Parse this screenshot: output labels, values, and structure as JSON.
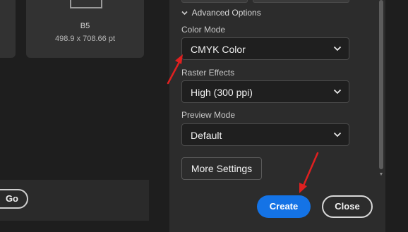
{
  "preset": {
    "name": "B5",
    "size": "498.9 x 708.66 pt"
  },
  "left_bottom": {
    "go_label": "Go"
  },
  "panel": {
    "advanced_options_label": "Advanced Options",
    "fields": [
      {
        "label": "Color Mode",
        "value": "CMYK Color"
      },
      {
        "label": "Raster Effects",
        "value": "High (300 ppi)"
      },
      {
        "label": "Preview Mode",
        "value": "Default"
      }
    ],
    "more_settings_label": "More Settings",
    "create_label": "Create",
    "close_label": "Close"
  },
  "icons": [
    "chevron-down-icon",
    "dropdown-caret-icon",
    "scroll-down-arrow-icon",
    "annotation-arrow-icon",
    "paper-size-icon"
  ],
  "colors": {
    "accent": "#1473e6",
    "annotation": "#e02020",
    "panel_bg": "#2c2c2c",
    "app_bg": "#1e1e1e"
  }
}
